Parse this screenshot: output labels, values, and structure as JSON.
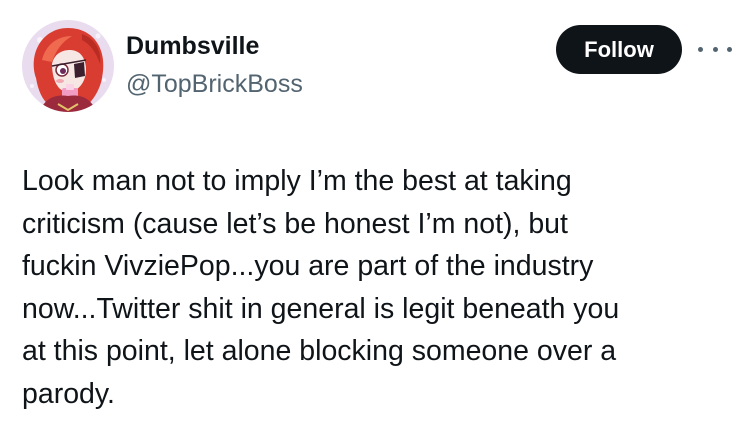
{
  "user": {
    "display_name": "Dumbsville",
    "handle": "@TopBrickBoss",
    "avatar_icon": "profile-avatar"
  },
  "actions": {
    "follow_label": "Follow",
    "more_icon": "more-options-icon"
  },
  "tweet": {
    "lines": [
      "Look man not to imply I’m the best at taking",
      "criticism (cause let’s be honest I’m not), but",
      "fuckin VivziePop...you are part of the industry",
      "now...Twitter shit in general is legit beneath you",
      "at this point, let alone blocking someone over a",
      "parody."
    ]
  },
  "colors": {
    "text": "#0f1419",
    "secondary_text": "#536471",
    "follow_bg": "#0f1419",
    "follow_text": "#ffffff"
  }
}
